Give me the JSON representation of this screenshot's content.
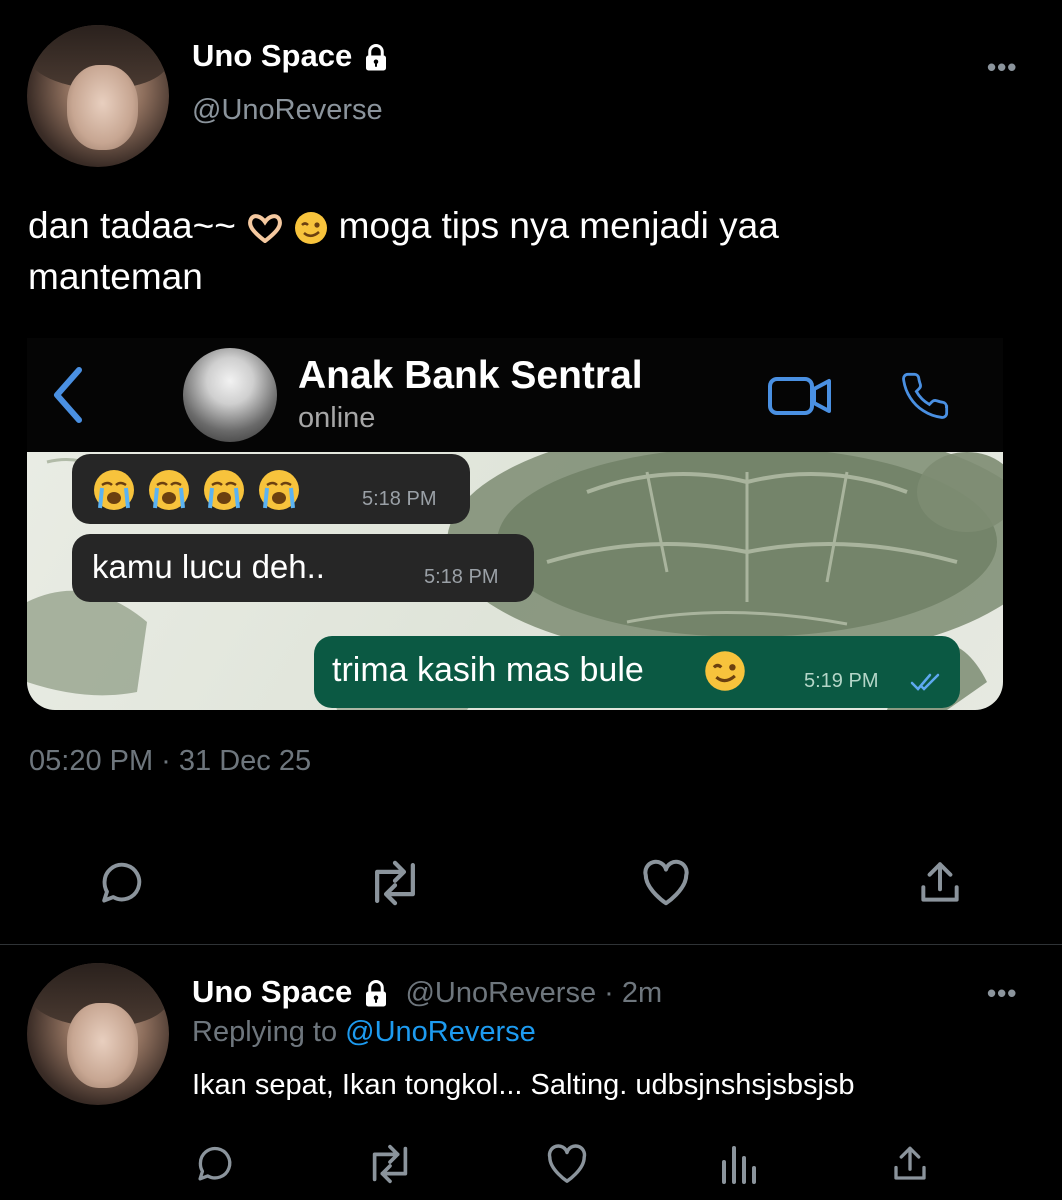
{
  "tweet": {
    "author_name": "Uno Space",
    "author_handle": "@UnoReverse",
    "text_part1": "dan tadaa~~ ",
    "text_part2": " moga tips nya menjadi yaa",
    "text_line2": "manteman",
    "timestamp": "05:20 PM · 31 Dec 25"
  },
  "chat": {
    "contact_name": "Anak Bank Sentral",
    "status": "online",
    "messages": [
      {
        "direction": "in",
        "text": "",
        "time": "5:18 PM"
      },
      {
        "direction": "in",
        "text": "kamu lucu deh..",
        "time": "5:18 PM"
      },
      {
        "direction": "out",
        "text": "trima kasih mas bule",
        "time": "5:19 PM"
      }
    ]
  },
  "reply": {
    "author_name": "Uno Space",
    "author_handle": "@UnoReverse · 2m",
    "replying_label": "Replying to ",
    "replying_handle": "@UnoReverse",
    "text": "Ikan sepat, Ikan tongkol... Salting. udbsjnshsjsbsjsb"
  },
  "icons": {
    "lock": "lock-icon",
    "more": "more-icon",
    "back": "chevron-left-icon",
    "video": "video-call-icon",
    "phone": "phone-icon",
    "reply": "reply-icon",
    "retweet": "retweet-icon",
    "like": "heart-icon",
    "share": "share-icon",
    "analytics": "analytics-icon"
  },
  "colors": {
    "accent": "#1d9bf0",
    "chat_accent": "#4a90e2",
    "outgoing_bubble": "#0b5943",
    "incoming_bubble": "#262626"
  }
}
